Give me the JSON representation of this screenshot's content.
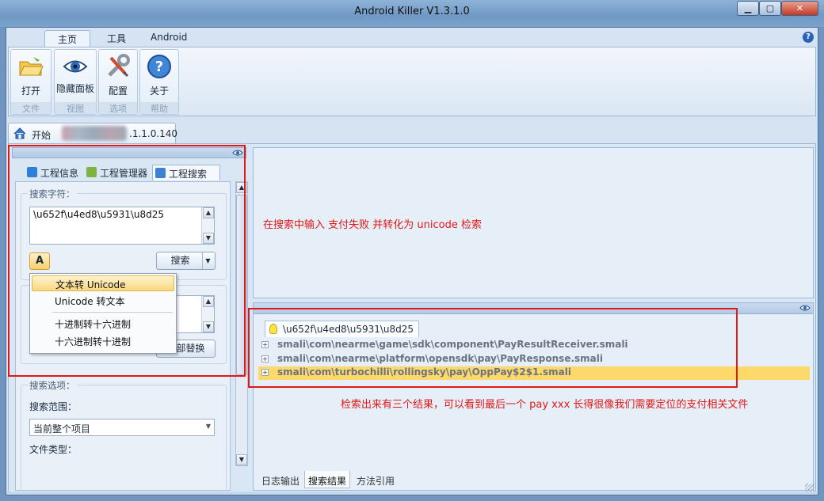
{
  "window": {
    "title": "Android Killer V1.3.1.0"
  },
  "ribbon": {
    "tabs": [
      {
        "label": "主页"
      },
      {
        "label": "工具"
      },
      {
        "label": "Android"
      }
    ],
    "groups": [
      {
        "button": "打开",
        "group": "文件",
        "icon": "folder-open-icon"
      },
      {
        "button": "隐藏面板",
        "group": "视图",
        "icon": "eye-icon"
      },
      {
        "button": "配置",
        "group": "选项",
        "icon": "wrench-screwdriver-icon"
      },
      {
        "button": "关于",
        "group": "帮助",
        "icon": "help-icon"
      }
    ]
  },
  "doc_tab": {
    "home": "开始",
    "version": ".1.1.0.140"
  },
  "left_panel": {
    "tabs": [
      {
        "label": "工程信息"
      },
      {
        "label": "工程管理器"
      },
      {
        "label": "工程搜索"
      }
    ],
    "search": {
      "legend": "搜索字符：",
      "value": "\\u652f\\u4ed8\\u5931\\u8d25",
      "button": "搜索",
      "convert_button": "A"
    },
    "replace": {
      "button": "全部替换"
    },
    "options": {
      "legend": "搜索选项：",
      "range_label": "搜索范围：",
      "range_value": "当前整个项目",
      "filetype_label": "文件类型："
    }
  },
  "context_menu": {
    "items": [
      {
        "label": "文本转 Unicode",
        "highlighted": true
      },
      {
        "label": "Unicode 转文本",
        "highlighted": false
      },
      {
        "label": "十进制转十六进制",
        "highlighted": false
      },
      {
        "label": "十六进制转十进制",
        "highlighted": false
      }
    ]
  },
  "results": {
    "tab_label": "\\u652f\\u4ed8\\u5931\\u8d25",
    "rows": [
      {
        "path": "smali\\com\\nearme\\game\\sdk\\component\\PayResultReceiver.smali",
        "selected": false
      },
      {
        "path": "smali\\com\\nearme\\platform\\opensdk\\pay\\PayResponse.smali",
        "selected": false
      },
      {
        "path": "smali\\com\\turbochilli\\rollingsky\\pay\\OppPay$2$1.smali",
        "selected": true
      }
    ],
    "bottom_tabs": [
      {
        "label": "日志输出"
      },
      {
        "label": "搜索结果"
      },
      {
        "label": "方法引用"
      }
    ]
  },
  "annotations": {
    "top": "在搜索中输入 支付失败 并转化为 unicode 检索",
    "bottom": "检索出来有三个结果，可以看到最后一个 pay xxx 长得很像我们需要定位的支付相关文件"
  },
  "colors": {
    "accent": "#e01818",
    "selection": "#fdd96c"
  }
}
